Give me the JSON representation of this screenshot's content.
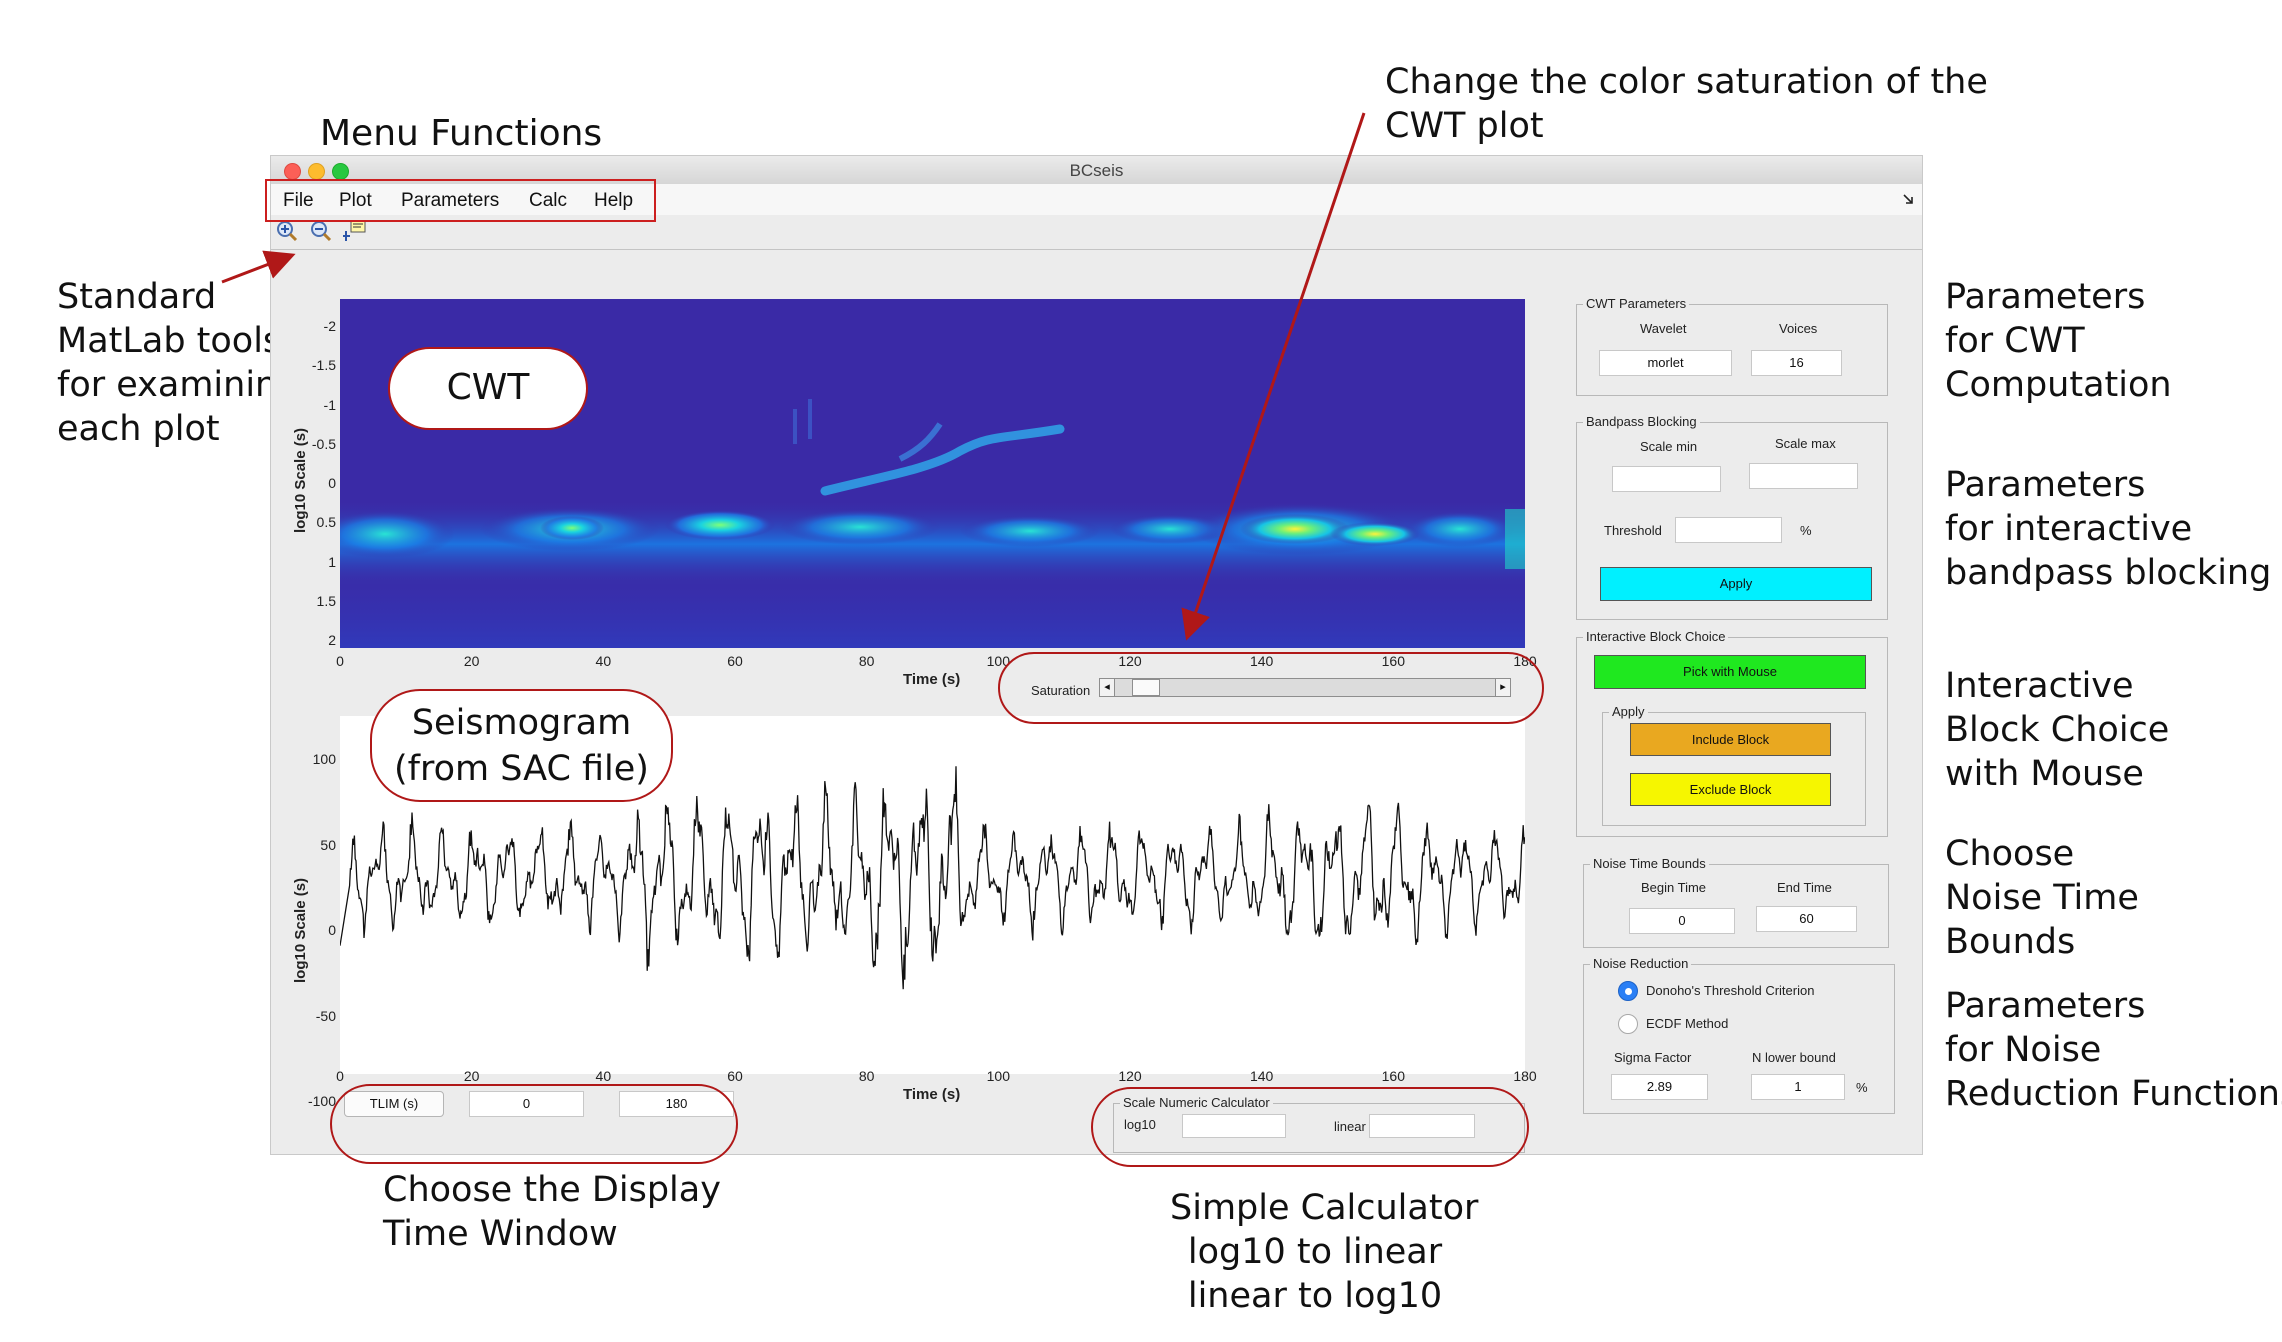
{
  "annotations": {
    "menu_functions": "Menu Functions",
    "color_saturation": [
      "Change the color saturation of the",
      "CWT plot"
    ],
    "standard_tools": [
      "Standard",
      "MatLab tools",
      "for examining",
      "each plot"
    ],
    "cwt_params": [
      "Parameters",
      "for CWT",
      "Computation"
    ],
    "bandpass_params": [
      "Parameters",
      "for interactive",
      "bandpass blocking"
    ],
    "block_choice": [
      "Interactive",
      "Block Choice",
      "with Mouse"
    ],
    "noise_bounds": [
      "Choose",
      "Noise Time",
      "Bounds"
    ],
    "noise_reduction": [
      "Parameters",
      "for Noise",
      "Reduction Functions"
    ],
    "display_window": [
      "Choose the Display",
      "Time Window"
    ],
    "calculator": [
      "Simple Calculator",
      "log10 to linear",
      "linear to log10"
    ]
  },
  "window": {
    "title": "BCseis",
    "menu": [
      "File",
      "Plot",
      "Parameters",
      "Calc",
      "Help"
    ],
    "toolbar_icons": [
      "zoom-in-icon",
      "zoom-out-icon",
      "data-cursor-icon"
    ]
  },
  "callouts": {
    "cwt": "CWT",
    "seismogram": [
      "Seismogram",
      "(from SAC file)"
    ]
  },
  "cwt_plot": {
    "ylabel": "log10 Scale (s)",
    "xlabel": "Time (s)",
    "yticks": [
      "-2",
      "-1.5",
      "-1",
      "-0.5",
      "0",
      "0.5",
      "1",
      "1.5",
      "2"
    ],
    "xticks": [
      "0",
      "20",
      "40",
      "60",
      "80",
      "100",
      "120",
      "140",
      "160",
      "180"
    ]
  },
  "saturation": {
    "label": "Saturation",
    "value_fraction": 0.05
  },
  "seis_plot": {
    "ylabel": "log10 Scale (s)",
    "xlabel": "Time (s)",
    "yticks": [
      "100",
      "50",
      "0",
      "-50",
      "-100"
    ],
    "xticks": [
      "0",
      "20",
      "40",
      "60",
      "80",
      "100",
      "120",
      "140",
      "160",
      "180"
    ]
  },
  "tlim": {
    "button": "TLIM (s)",
    "start": "0",
    "end": "180"
  },
  "calculator": {
    "title": "Scale Numeric Calculator",
    "log10_label": "log10",
    "linear_label": "linear",
    "log10_value": "",
    "linear_value": ""
  },
  "cwt_params": {
    "title": "CWT Parameters",
    "wavelet_label": "Wavelet",
    "voices_label": "Voices",
    "wavelet_value": "morlet",
    "voices_value": "16"
  },
  "bandpass": {
    "title": "Bandpass Blocking",
    "scale_min_label": "Scale min",
    "scale_max_label": "Scale max",
    "threshold_label": "Threshold",
    "percent": "%",
    "apply_label": "Apply",
    "apply_color": "#00f0ff"
  },
  "block_choice": {
    "title": "Interactive Block Choice",
    "pick_label": "Pick with Mouse",
    "pick_color": "#1fe81f",
    "apply_title": "Apply",
    "include_label": "Include Block",
    "include_color": "#e9a820",
    "exclude_label": "Exclude Block",
    "exclude_color": "#f6f600"
  },
  "noise_bounds": {
    "title": "Noise Time Bounds",
    "begin_label": "Begin Time",
    "end_label": "End Time",
    "begin_value": "0",
    "end_value": "60"
  },
  "noise_reduction": {
    "title": "Noise Reduction",
    "option1": "Donoho's Threshold Criterion",
    "option2": "ECDF Method",
    "selected": "Donoho's Threshold Criterion",
    "sigma_label": "Sigma Factor",
    "nlower_label": "N lower bound",
    "sigma_value": "2.89",
    "nlower_value": "1",
    "percent": "%"
  },
  "colors": {
    "annotation_red": "#b01818",
    "cwt_background": "#3a2aa6"
  }
}
